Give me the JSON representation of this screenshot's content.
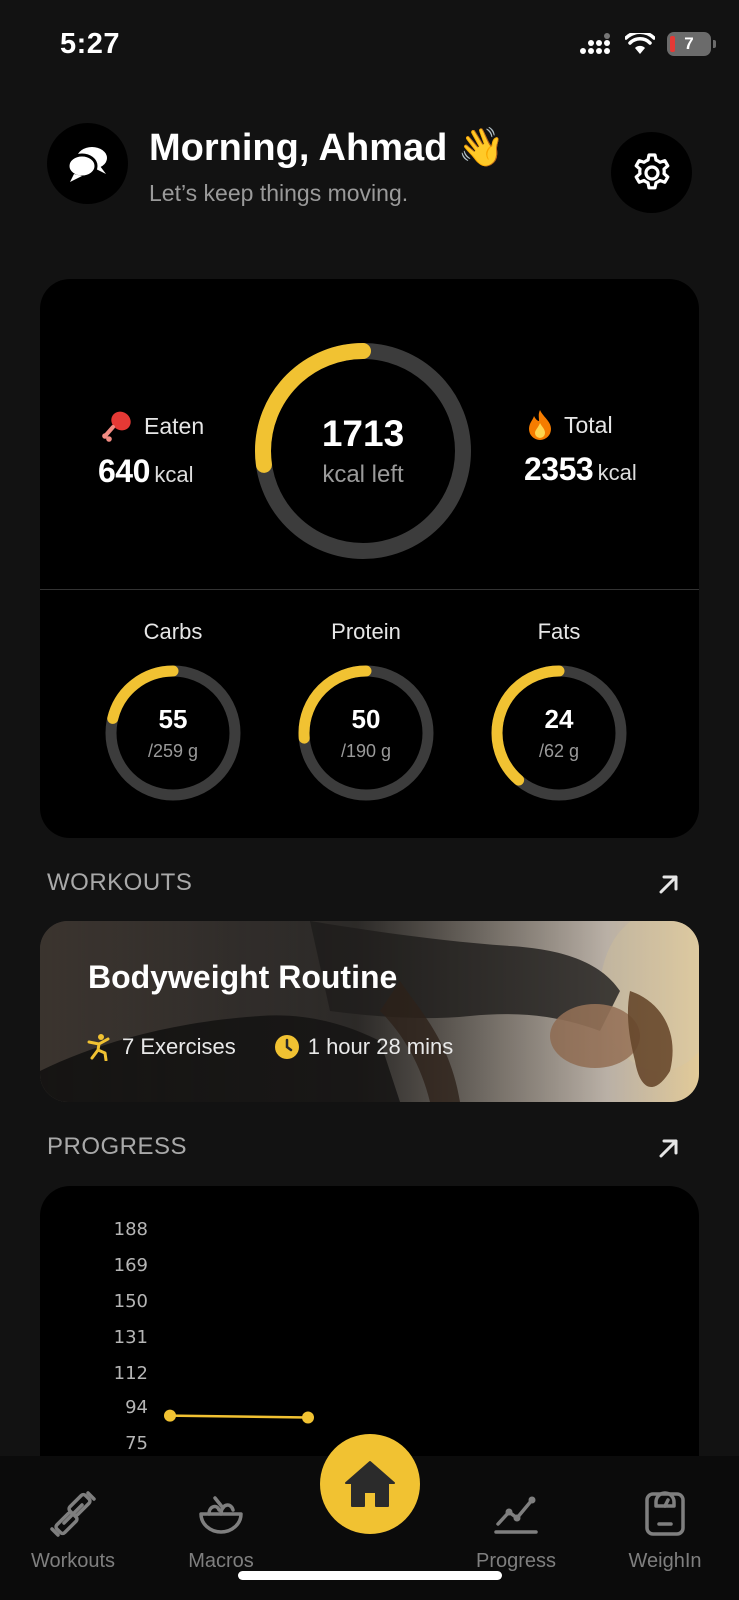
{
  "status_bar": {
    "time": "5:27",
    "battery": "7"
  },
  "header": {
    "greeting": "Morning, Ahmad 👋",
    "subtitle": "Let’s keep things moving."
  },
  "calories": {
    "eaten_label": "Eaten",
    "eaten_value": "640",
    "eaten_unit": "kcal",
    "total_label": "Total",
    "total_value": "2353",
    "total_unit": "kcal",
    "left_value": "1713",
    "left_label": "kcal left",
    "left_ring_progress": 0.272
  },
  "macros": [
    {
      "label": "Carbs",
      "value": "55",
      "goal": "/259 g",
      "progress": 0.212
    },
    {
      "label": "Protein",
      "value": "50",
      "goal": "/190 g",
      "progress": 0.263
    },
    {
      "label": "Fats",
      "value": "24",
      "goal": "/62 g",
      "progress": 0.387
    }
  ],
  "sections": {
    "workouts_title": "WORKOUTS",
    "progress_title": "PROGRESS"
  },
  "workout": {
    "title": "Bodyweight Routine",
    "exercises": "7 Exercises",
    "duration": "1 hour 28 mins"
  },
  "chart_data": {
    "type": "line",
    "y_ticks": [
      "188",
      "169",
      "150",
      "131",
      "112",
      "94",
      "75"
    ],
    "ylim": [
      75,
      188
    ],
    "series": [
      {
        "values": [
          90,
          89
        ]
      }
    ]
  },
  "tabs": [
    {
      "label": "Workouts",
      "icon": "dumbbell-icon"
    },
    {
      "label": "Macros",
      "icon": "bowl-icon"
    },
    {
      "label": "Progress",
      "icon": "chart-icon"
    },
    {
      "label": "WeighIn",
      "icon": "scale-icon"
    }
  ],
  "colors": {
    "accent": "#f1c232",
    "ring_track": "#3c3c3c",
    "background": "#121212",
    "card": "#000000"
  }
}
